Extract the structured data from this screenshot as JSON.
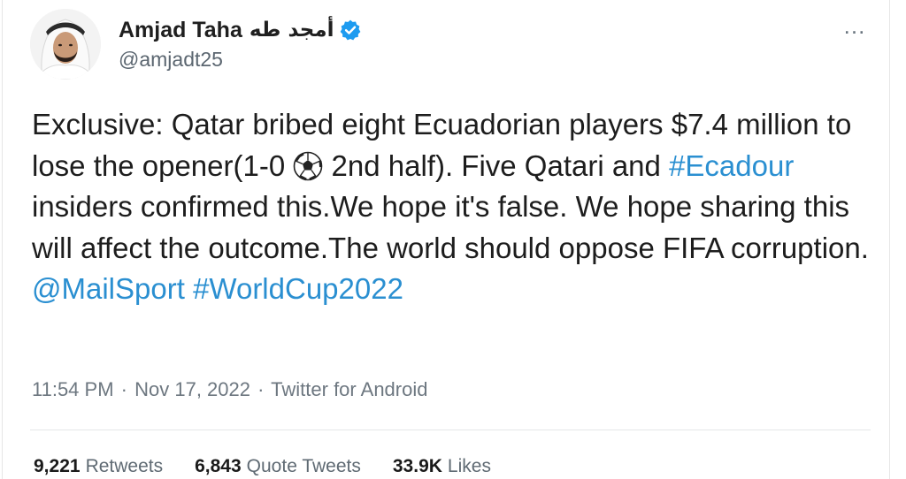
{
  "author": {
    "display_name": "Amjad Taha",
    "arabic_name": "أمجد طه",
    "handle": "@amjadt25",
    "verified": true,
    "more_label": "..."
  },
  "tweet": {
    "segments": [
      {
        "type": "text",
        "value": "Exclusive: Qatar bribed eight Ecuadorian players $7.4 million to lose the opener(1-0 "
      },
      {
        "type": "icon",
        "icon": "soccer-ball-icon"
      },
      {
        "type": "text",
        "value": " 2nd half). Five Qatari and "
      },
      {
        "type": "link",
        "value": "#Ecadour"
      },
      {
        "type": "text",
        "value": " insiders confirmed this.We hope it's false. We hope sharing this will affect the outcome.The world should oppose FIFA corruption. "
      },
      {
        "type": "link",
        "value": "@MailSport"
      },
      {
        "type": "text",
        "value": " "
      },
      {
        "type": "link",
        "value": "#WorldCup2022"
      }
    ]
  },
  "meta": {
    "time": "11:54 PM",
    "separator": "·",
    "date": "Nov 17, 2022",
    "source": "Twitter for Android"
  },
  "stats": {
    "retweets_count": "9,221",
    "retweets_label": "Retweets",
    "quotes_count": "6,843",
    "quotes_label": "Quote Tweets",
    "likes_count": "33.9K",
    "likes_label": "Likes"
  },
  "colors": {
    "link": "#2a8fd1",
    "verified": "#1d9bf0",
    "muted": "#6d7780"
  }
}
